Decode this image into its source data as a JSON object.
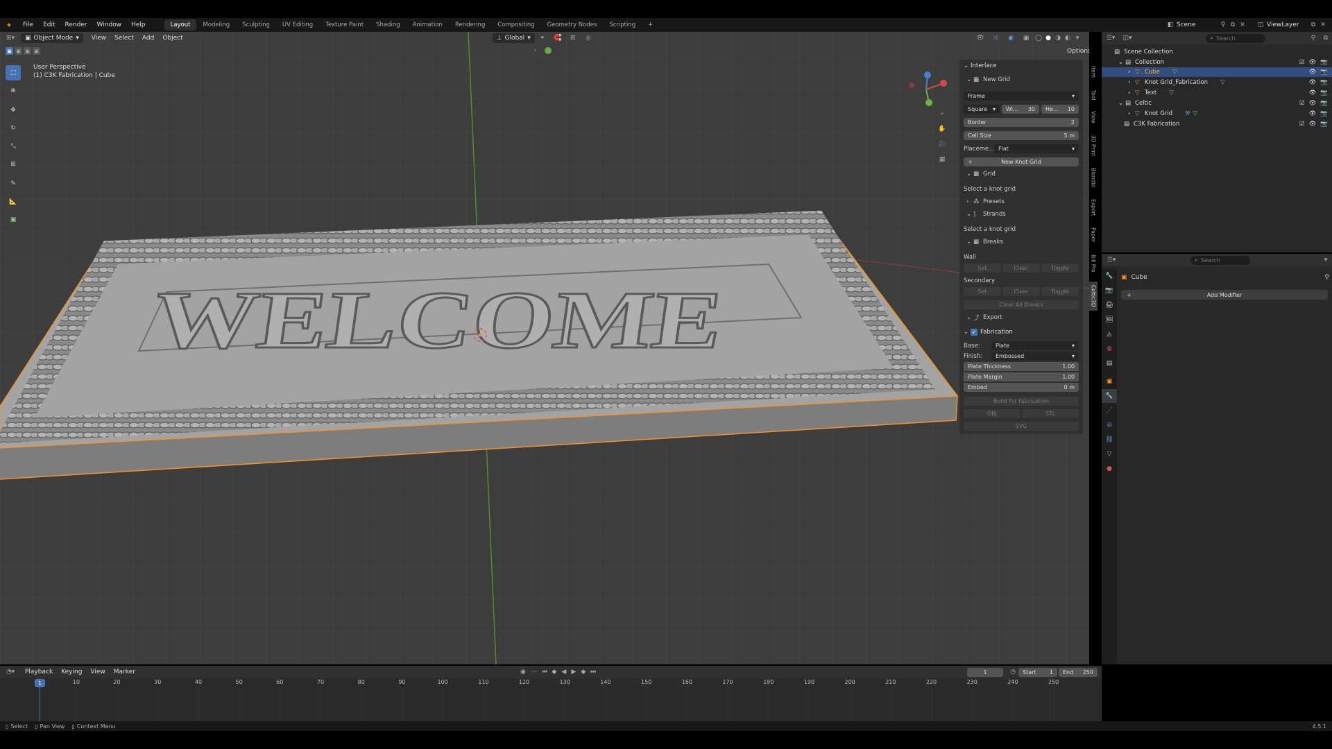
{
  "topbar": {
    "menus": [
      "File",
      "Edit",
      "Render",
      "Window",
      "Help"
    ],
    "workspaces": [
      "Layout",
      "Modeling",
      "Sculpting",
      "UV Editing",
      "Texture Paint",
      "Shading",
      "Animation",
      "Rendering",
      "Compositing",
      "Geometry Nodes",
      "Scripting"
    ],
    "active_workspace": "Layout",
    "scene": "Scene",
    "view_layer": "ViewLayer"
  },
  "viewport": {
    "mode": "Object Mode",
    "menus": [
      "View",
      "Select",
      "Add",
      "Object"
    ],
    "transform": "Global",
    "options": "Options",
    "perspective": "User Perspective",
    "context": "(1) C3K Fabrication | Cube",
    "welcome_text": "WELCOME"
  },
  "npanel": {
    "interlace": "Interlace",
    "new_grid": "New Grid",
    "frame": "Frame",
    "shape": "Square",
    "width_label": "Wi...",
    "width_value": "30",
    "height_label": "He...",
    "height_value": "10",
    "border_label": "Border",
    "border_value": "2",
    "cell_size_label": "Cell Size",
    "cell_size_value": "5 m",
    "placement_label": "Placeme...",
    "placement_value": "Flat",
    "new_knot_grid": "New Knot Grid",
    "grid": "Grid",
    "select_knot_grid_1": "Select a knot grid",
    "presets": "Presets",
    "strands": "Strands",
    "select_knot_grid_2": "Select a knot grid",
    "breaks": "Breaks",
    "wall": "Wall",
    "secondary": "Secondary",
    "set": "Set",
    "clear": "Clear",
    "toggle": "Toggle",
    "clear_all_breaks": "Clear All Breaks",
    "export": "Export",
    "fabrication": "Fabrication",
    "base_label": "Base:",
    "base_value": "Plate",
    "finish_label": "Finish:",
    "finish_value": "Embossed",
    "plate_thickness_label": "Plate Thickness",
    "plate_thickness_value": "1.00",
    "plate_margin_label": "Plate Margin",
    "plate_margin_value": "1.00",
    "embed_label": "Embed",
    "embed_value": "0 m",
    "build_for_fabrication": "Build for Fabrication",
    "obj": "OBJ",
    "stl": "STL",
    "svg": "SVG"
  },
  "side_tabs": [
    "Item",
    "Tool",
    "View",
    "3D Print",
    "Blendio",
    "Export",
    "Paper",
    "Bill Pro",
    "Celtic3D"
  ],
  "outliner": {
    "search_placeholder": "Search",
    "scene_collection": "Scene Collection",
    "items": [
      {
        "name": "Collection",
        "depth": 1
      },
      {
        "name": "Cube",
        "depth": 2,
        "selected": true
      },
      {
        "name": "Knot Grid_Fabrication",
        "depth": 2
      },
      {
        "name": "Text",
        "depth": 2
      },
      {
        "name": "Celtic",
        "depth": 1
      },
      {
        "name": "Knot Grid",
        "depth": 2
      },
      {
        "name": "C3K Fabrication",
        "depth": 1
      }
    ]
  },
  "properties": {
    "search_placeholder": "Search",
    "object_name": "Cube",
    "add_modifier": "Add Modifier"
  },
  "timeline": {
    "menus": [
      "Playback",
      "Keying",
      "View",
      "Marker"
    ],
    "current_frame": "1",
    "start_label": "Start",
    "start_value": "1",
    "end_label": "End",
    "end_value": "250",
    "ticks": [
      "10",
      "20",
      "30",
      "40",
      "50",
      "60",
      "70",
      "80",
      "90",
      "100",
      "110",
      "120",
      "130",
      "140",
      "150",
      "160",
      "170",
      "180",
      "190",
      "200",
      "210",
      "220",
      "230",
      "240",
      "250"
    ],
    "playhead": "1"
  },
  "statusbar": {
    "select": "Select",
    "pan_view": "Pan View",
    "context_menu": "Context Menu",
    "version": "4.5.1"
  },
  "colors": {
    "accent": "#4772b3",
    "selection_orange": "#f5922e",
    "viewport_bg": "#3d3d3d"
  }
}
